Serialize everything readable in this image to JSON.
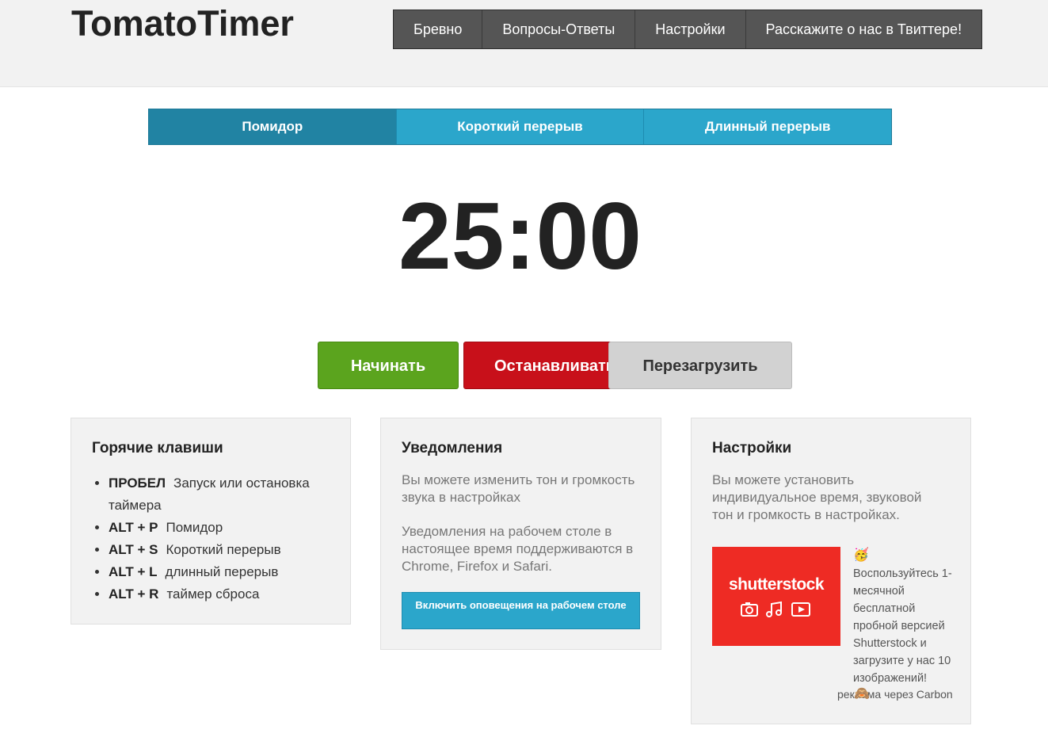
{
  "brand": {
    "logo": "TomatoTimer"
  },
  "topnav": [
    "Бревно",
    "Вопросы-Ответы",
    "Настройки",
    "Расскажите о нас в Твиттере!"
  ],
  "modes": [
    {
      "label": "Помидор",
      "active": true
    },
    {
      "label": "Короткий перерыв",
      "active": false
    },
    {
      "label": "Длинный перерыв",
      "active": false
    }
  ],
  "timer": {
    "display": "25:00"
  },
  "controls": {
    "start": "Начинать",
    "stop": "Останавливать",
    "reset": "Перезагрузить"
  },
  "hotkeys": {
    "title": "Горячие клавиши",
    "items": [
      {
        "key": "ПРОБЕЛ",
        "desc": "Запуск или остановка таймера"
      },
      {
        "key": "ALT + P",
        "desc": "Помидор"
      },
      {
        "key": "ALT + S",
        "desc": "Короткий перерыв"
      },
      {
        "key": "ALT + L",
        "desc": "длинный перерыв"
      },
      {
        "key": "ALT + R",
        "desc": "таймер сброса"
      }
    ]
  },
  "notifications": {
    "title": "Уведомления",
    "text1": "Вы можете изменить тон и громкость звука в настройках",
    "text2": "Уведомления на рабочем столе в настоящее время поддерживаются в Chrome, Firefox и Safari.",
    "button": "Включить оповещения на рабочем столе"
  },
  "settings": {
    "title": "Настройки",
    "text": "Вы можете установить индивидуальное время, звуковой тон и громкость в настройках.",
    "ad": {
      "brand": "shutterstock",
      "emoji": "🥳",
      "text": "Воспользуйтесь 1-месячной бесплатной пробной версией Shutterstock и загрузите у нас 10 изображений!",
      "via": "реклама через Carbon",
      "via_emoji": "🙈",
      "icons": [
        "camera-icon",
        "music-note-icon",
        "video-play-icon"
      ]
    }
  },
  "colors": {
    "header_bg": "#f2f2f2",
    "nav_bg": "#555555",
    "mode_tab": "#2ba6cb",
    "mode_tab_active": "#2183a3",
    "start": "#5ba41e",
    "stop": "#c8101a",
    "reset": "#d2d2d2",
    "ad_bg": "#ee2b24"
  }
}
